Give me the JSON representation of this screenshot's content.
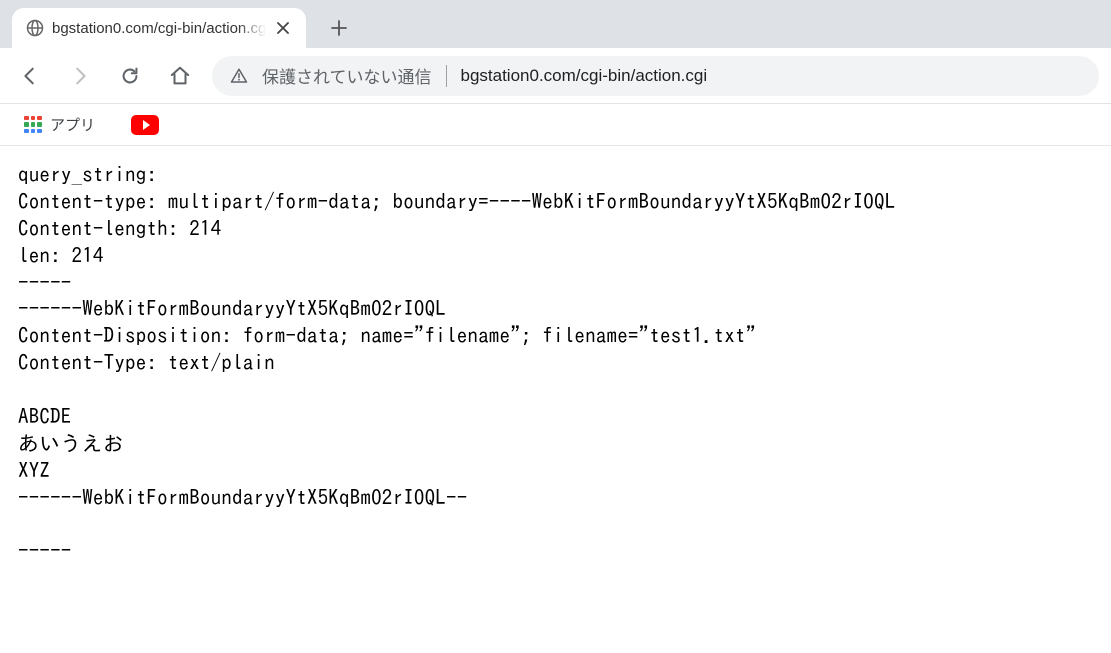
{
  "tab": {
    "title": "bgstation0.com/cgi-bin/action.cg"
  },
  "addressbar": {
    "security_label": "保護されていない通信",
    "url": "bgstation0.com/cgi-bin/action.cgi"
  },
  "bookmarks": {
    "apps_label": "アプリ"
  },
  "page": {
    "body_text": "query_string:\nContent-type: multipart/form-data; boundary=----WebKitFormBoundaryyYtX5KqBmO2rIOQL\nContent-length: 214\nlen: 214\n-----\n------WebKitFormBoundaryyYtX5KqBmO2rIOQL\nContent-Disposition: form-data; name=\"filename\"; filename=\"test1.txt\"\nContent-Type: text/plain\n\nABCDE\nあいうえお\nXYZ\n------WebKitFormBoundaryyYtX5KqBmO2rIOQL--\n\n-----"
  }
}
